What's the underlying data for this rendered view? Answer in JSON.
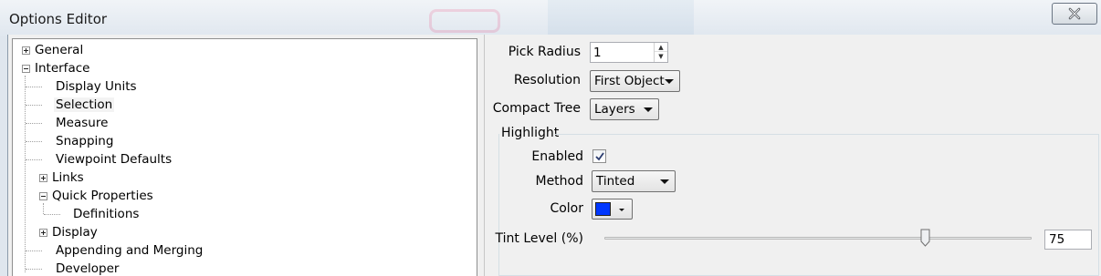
{
  "window": {
    "title": "Options Editor"
  },
  "tree": {
    "items": [
      {
        "label": "General",
        "level": 0,
        "expander": "plus"
      },
      {
        "label": "Interface",
        "level": 0,
        "expander": "minus"
      },
      {
        "label": "Display Units",
        "level": 1
      },
      {
        "label": "Selection",
        "level": 1,
        "selected": true
      },
      {
        "label": "Measure",
        "level": 1
      },
      {
        "label": "Snapping",
        "level": 1
      },
      {
        "label": "Viewpoint Defaults",
        "level": 1
      },
      {
        "label": "Links",
        "level": 1,
        "expander": "plus"
      },
      {
        "label": "Quick Properties",
        "level": 1,
        "expander": "minus"
      },
      {
        "label": "Definitions",
        "level": 2
      },
      {
        "label": "Display",
        "level": 1,
        "expander": "plus"
      },
      {
        "label": "Appending and Merging",
        "level": 1
      },
      {
        "label": "Developer",
        "level": 1
      }
    ]
  },
  "selection": {
    "pick_radius_label": "Pick Radius",
    "pick_radius_value": "1",
    "resolution_label": "Resolution",
    "resolution_value": "First Object",
    "compact_tree_label": "Compact Tree",
    "compact_tree_value": "Layers",
    "highlight": {
      "group_label": "Highlight",
      "enabled_label": "Enabled",
      "enabled": true,
      "method_label": "Method",
      "method_value": "Tinted",
      "color_label": "Color",
      "color_value": "#0037ff",
      "tint_label": "Tint Level (%)",
      "tint_value": "75"
    }
  }
}
